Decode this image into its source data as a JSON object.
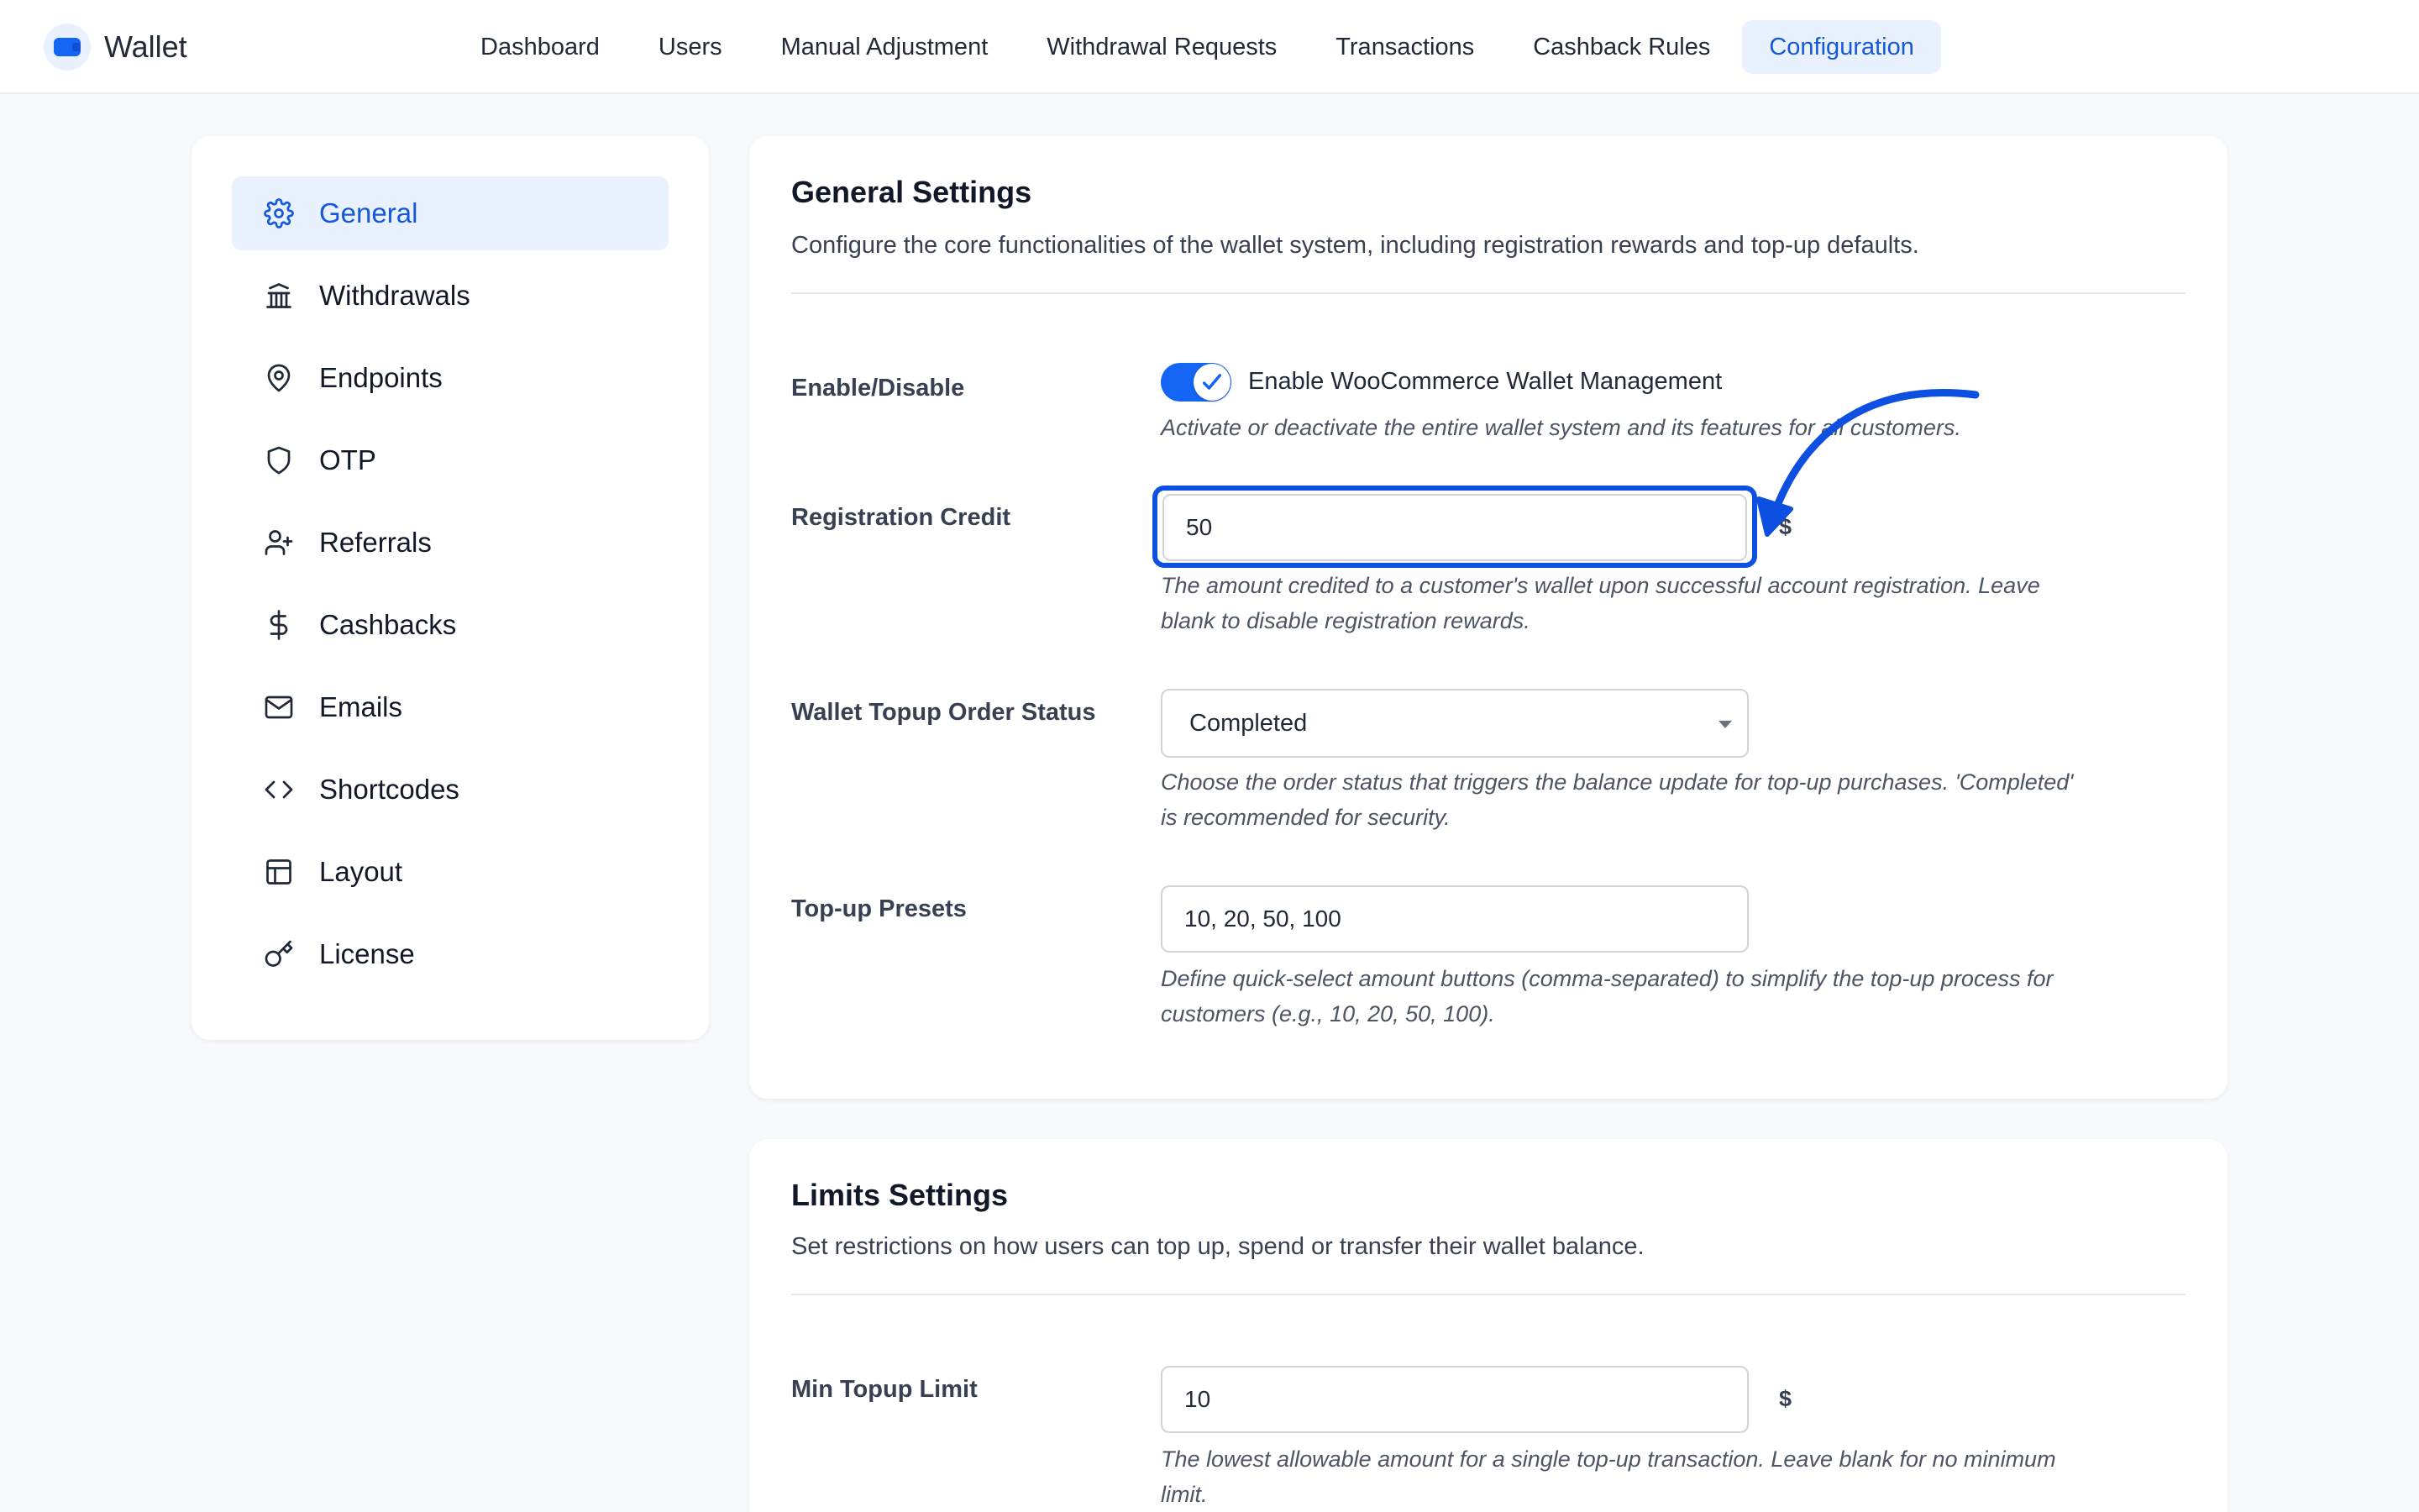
{
  "app": {
    "title": "Wallet"
  },
  "nav": {
    "items": [
      {
        "label": "Dashboard"
      },
      {
        "label": "Users"
      },
      {
        "label": "Manual Adjustment"
      },
      {
        "label": "Withdrawal Requests"
      },
      {
        "label": "Transactions"
      },
      {
        "label": "Cashback Rules"
      },
      {
        "label": "Configuration",
        "active": true
      }
    ]
  },
  "sidebar": {
    "items": [
      {
        "label": "General",
        "icon": "gear-icon",
        "active": true
      },
      {
        "label": "Withdrawals",
        "icon": "bank-icon"
      },
      {
        "label": "Endpoints",
        "icon": "map-pin-icon"
      },
      {
        "label": "OTP",
        "icon": "shield-icon"
      },
      {
        "label": "Referrals",
        "icon": "user-plus-icon"
      },
      {
        "label": "Cashbacks",
        "icon": "dollar-icon"
      },
      {
        "label": "Emails",
        "icon": "mail-icon"
      },
      {
        "label": "Shortcodes",
        "icon": "code-icon"
      },
      {
        "label": "Layout",
        "icon": "layout-icon"
      },
      {
        "label": "License",
        "icon": "key-icon"
      }
    ]
  },
  "general": {
    "title": "General Settings",
    "description": "Configure the core functionalities of the wallet system, including registration rewards and top-up defaults.",
    "enable": {
      "label": "Enable/Disable",
      "toggle_label": "Enable WooCommerce Wallet Management",
      "checked": true,
      "help": "Activate or deactivate the entire wallet system and its features for all customers."
    },
    "registration_credit": {
      "label": "Registration Credit",
      "value": "50",
      "currency": "$",
      "help_line1": "The amount credited to a customer's wallet upon successful account registration. Leave",
      "help_line2": "blank to disable registration rewards."
    },
    "topup_status": {
      "label": "Wallet Topup Order Status",
      "selected": "Completed",
      "help_line1": "Choose the order status that triggers the balance update for top-up purchases. 'Completed'",
      "help_line2": "is recommended for security."
    },
    "topup_presets": {
      "label": "Top-up Presets",
      "value": "10, 20, 50, 100",
      "help_line1": "Define quick-select amount buttons (comma-separated) to simplify the top-up process for",
      "help_line2": "customers (e.g., 10, 20, 50, 100)."
    }
  },
  "limits": {
    "title": "Limits Settings",
    "description": "Set restrictions on how users can top up, spend or transfer their wallet balance.",
    "min_topup": {
      "label": "Min Topup Limit",
      "value": "10",
      "currency": "$",
      "help_line1": "The lowest allowable amount for a single top-up transaction. Leave blank for no minimum",
      "help_line2": "limit."
    }
  },
  "colors": {
    "accent": "#1565f5",
    "highlight": "#0d4fe0",
    "active_bg": "#eaf1fe"
  }
}
